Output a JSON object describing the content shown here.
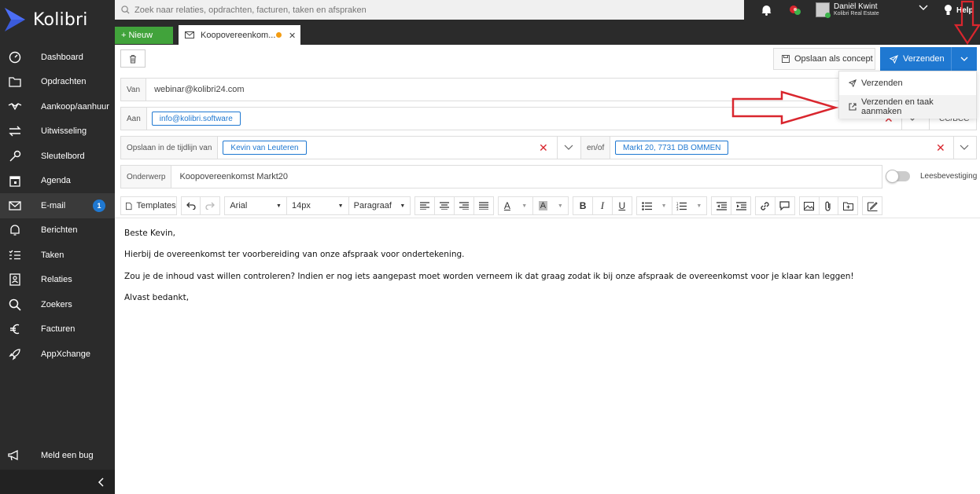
{
  "app": {
    "name": "Kolibri"
  },
  "search": {
    "placeholder": "Zoek naar relaties, opdrachten, facturen, taken en afspraken"
  },
  "user": {
    "name": "Daniël Kwint",
    "company": "Kolibri Real Estate",
    "help": "Help"
  },
  "nav": {
    "items": [
      {
        "label": "Dashboard",
        "icon": "dashboard-icon"
      },
      {
        "label": "Opdrachten",
        "icon": "folder-icon"
      },
      {
        "label": "Aankoop/aanhuur",
        "icon": "handshake-icon"
      },
      {
        "label": "Uitwisseling",
        "icon": "exchange-icon"
      },
      {
        "label": "Sleutelbord",
        "icon": "key-icon"
      },
      {
        "label": "Agenda",
        "icon": "calendar-icon"
      },
      {
        "label": "E-mail",
        "icon": "envelope-icon",
        "badge": "1"
      },
      {
        "label": "Berichten",
        "icon": "bell-icon"
      },
      {
        "label": "Taken",
        "icon": "tasks-icon"
      },
      {
        "label": "Relaties",
        "icon": "contact-icon"
      },
      {
        "label": "Zoekers",
        "icon": "search-icon"
      },
      {
        "label": "Facturen",
        "icon": "euro-icon"
      },
      {
        "label": "AppXchange",
        "icon": "rocket-icon"
      }
    ],
    "bug": "Meld een bug"
  },
  "tabs": {
    "new_label": "+ Nieuw",
    "active_tab": "Koopovereenkom..."
  },
  "toolbar": {
    "concept_label": "Opslaan als concept",
    "send_label": "Verzenden"
  },
  "menu": {
    "items": [
      "Verzenden",
      "Verzenden en taak aanmaken"
    ]
  },
  "form": {
    "from_label": "Van",
    "from_value": "webinar@kolibri24.com",
    "to_label": "Aan",
    "to_chip": "info@kolibri.software",
    "ccbcc_label": "CC/BCC",
    "timeline_label": "Opslaan in de tijdlijn van",
    "timeline_chip": "Kevin van Leuteren",
    "andor_label": "en/of",
    "address_chip": "Markt 20, 7731 DB OMMEN",
    "subject_label": "Onderwerp",
    "subject_value": "Koopovereenkomst Markt20",
    "read_receipt_label": "Leesbevestiging"
  },
  "editor": {
    "templates_label": "Templates",
    "font": "Arial",
    "size": "14px",
    "format": "Paragraaf",
    "body": [
      "Beste Kevin,",
      "Hierbij de overeenkomst ter voorbereiding van onze afspraak voor ondertekening.",
      "Zou je de inhoud vast willen controleren? Indien er nog iets aangepast moet worden verneem ik dat graag zodat ik bij onze afspraak de overeenkomst voor je klaar kan leggen!",
      "Alvast bedankt,"
    ]
  },
  "colors": {
    "sidebar": "#2b2b2b",
    "accent": "#1f78d1",
    "new_button": "#41a33b",
    "annotation": "#d9262e"
  }
}
